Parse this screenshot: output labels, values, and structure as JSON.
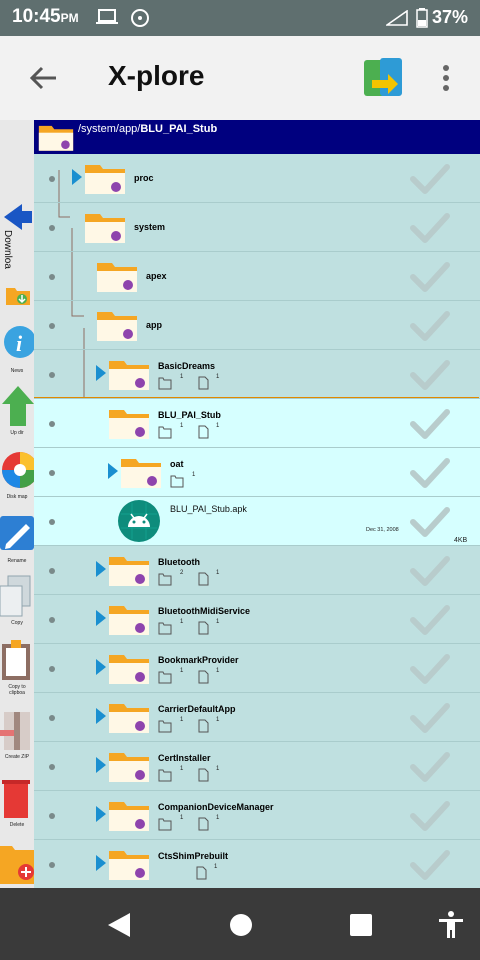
{
  "status": {
    "time": "10:45",
    "ampm": "PM",
    "battery": "37%"
  },
  "appbar": {
    "title": "X-plore"
  },
  "toolbar": {
    "vertical_label": "Downloa",
    "items": [
      "News",
      "Up dir",
      "Disk map",
      "Rename",
      "Copy",
      "Copy to clipboa",
      "Create ZIP",
      "Delete"
    ]
  },
  "path": {
    "prefix": "/system/app/",
    "current": "BLU_PAI_Stub"
  },
  "rows": [
    {
      "name": "proc",
      "type": "folder"
    },
    {
      "name": "system",
      "type": "folder"
    },
    {
      "name": "apex",
      "type": "folder"
    },
    {
      "name": "app",
      "type": "folder"
    },
    {
      "name": "BasicDreams",
      "type": "folder",
      "dirs": "1",
      "files": "1"
    },
    {
      "name": "BLU_PAI_Stub",
      "type": "folder",
      "dirs": "1",
      "files": "1"
    },
    {
      "name": "oat",
      "type": "folder",
      "dirs": "1"
    },
    {
      "name": "BLU_PAI_Stub.apk",
      "type": "apk",
      "date": "Dec 31, 2008",
      "size": "4KB"
    },
    {
      "name": "Bluetooth",
      "type": "folder",
      "dirs": "2",
      "files": "1"
    },
    {
      "name": "BluetoothMidiService",
      "type": "folder",
      "dirs": "1",
      "files": "1"
    },
    {
      "name": "BookmarkProvider",
      "type": "folder",
      "dirs": "1",
      "files": "1"
    },
    {
      "name": "CarrierDefaultApp",
      "type": "folder",
      "dirs": "1",
      "files": "1"
    },
    {
      "name": "CertInstaller",
      "type": "folder",
      "dirs": "1",
      "files": "1"
    },
    {
      "name": "CompanionDeviceManager",
      "type": "folder",
      "dirs": "1",
      "files": "1"
    },
    {
      "name": "CtsShimPrebuilt",
      "type": "folder",
      "files": "1"
    }
  ]
}
